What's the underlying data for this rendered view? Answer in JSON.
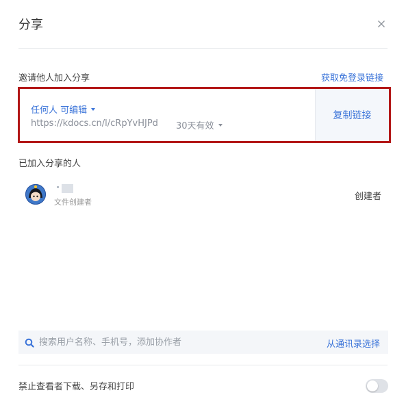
{
  "dialog": {
    "title": "分享",
    "close_icon": "close-icon"
  },
  "invite": {
    "label": "邀请他人加入分享",
    "free_login_link": "获取免登录链接",
    "permission": "任何人 可编辑",
    "url": "https://kdocs.cn/l/cRpYvHJPd",
    "expire": "30天有效",
    "copy_button": "复制链接",
    "highlight_color": "#b31818"
  },
  "members": {
    "label": "已加入分享的人",
    "items": [
      {
        "role_subtitle": "文件创建者",
        "role": "创建者"
      }
    ]
  },
  "search": {
    "placeholder": "搜索用户名称、手机号，添加协作者",
    "contacts_link": "从通讯录选择"
  },
  "settings": {
    "disable_download_label": "禁止查看者下载、另存和打印",
    "disable_download_enabled": false
  },
  "colors": {
    "link": "#3b74d9",
    "muted": "#8a8f99"
  }
}
